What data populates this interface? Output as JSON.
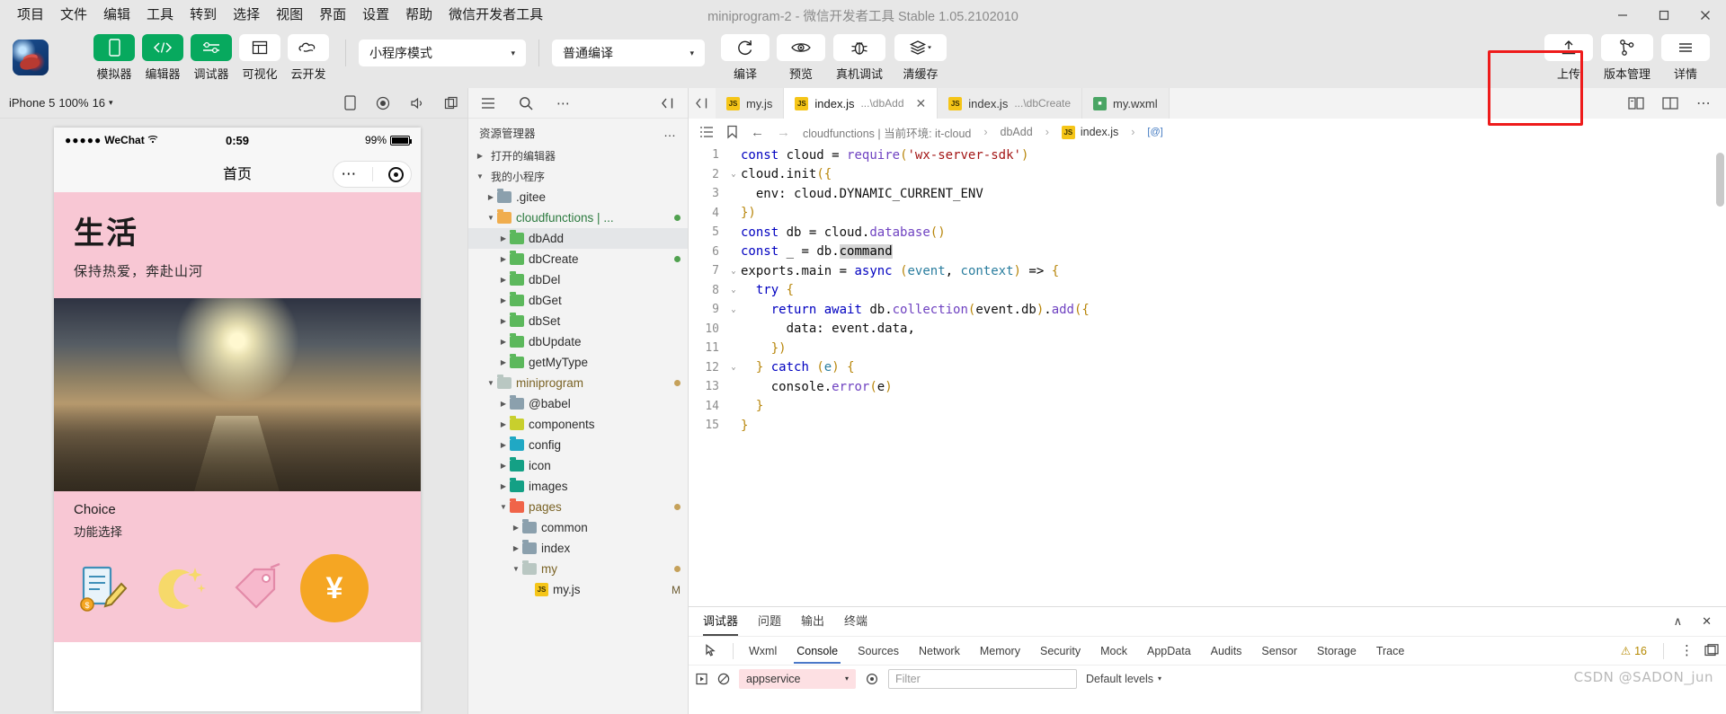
{
  "titlebar": {
    "menus": [
      "项目",
      "文件",
      "编辑",
      "工具",
      "转到",
      "选择",
      "视图",
      "界面",
      "设置",
      "帮助",
      "微信开发者工具"
    ],
    "window_title": "miniprogram-2  -  微信开发者工具 Stable 1.05.2102010",
    "controls": {
      "minimize": "─",
      "maximize": "☐",
      "close": "✕"
    }
  },
  "toolbar": {
    "mode_buttons": [
      {
        "label": "模拟器",
        "icon": "phone-icon",
        "style": "green"
      },
      {
        "label": "编辑器",
        "icon": "code-icon",
        "style": "green"
      },
      {
        "label": "调试器",
        "icon": "sliders-icon",
        "style": "green"
      },
      {
        "label": "可视化",
        "icon": "layout-icon",
        "style": "white"
      },
      {
        "label": "云开发",
        "icon": "cloud-icon",
        "style": "white"
      }
    ],
    "mode_select": {
      "value": "小程序模式",
      "caret": "▾"
    },
    "compile_select": {
      "value": "普通编译",
      "caret": "▾"
    },
    "action_buttons": [
      {
        "label": "编译",
        "icon": "refresh-icon"
      },
      {
        "label": "预览",
        "icon": "eye-icon"
      },
      {
        "label": "真机调试",
        "icon": "bug-icon"
      },
      {
        "label": "清缓存",
        "icon": "layers-icon",
        "caret": "▾"
      }
    ],
    "right_buttons": [
      {
        "label": "上传",
        "icon": "upload-icon",
        "highlighted": true
      },
      {
        "label": "版本管理",
        "icon": "git-branch-icon"
      },
      {
        "label": "详情",
        "icon": "hamburger-icon"
      }
    ],
    "highlight_color": "#ee1b1b",
    "accent_color": "#07a95e"
  },
  "simulator": {
    "device": "iPhone 5",
    "zoom": "100%",
    "scale": "16",
    "caret": "▾",
    "toolbar_icons": [
      "rotate-icon",
      "record-icon",
      "sound-icon",
      "copy-icon"
    ],
    "phone": {
      "status_bar": {
        "carrier": "WeChat",
        "signal_dots": "●●●●●",
        "wifi": "📶",
        "time": "0:59",
        "battery": "99%"
      },
      "nav_title": "首页",
      "banner": {
        "title": "生活",
        "subtitle": "保持热爱，奔赴山河"
      },
      "choice": {
        "title": "Choice",
        "subtitle": "功能选择"
      },
      "feature_icons": [
        "notepad-icon",
        "moon-icon",
        "tag-icon",
        "yuan-icon"
      ],
      "yuan_symbol": "¥"
    }
  },
  "explorer": {
    "title": "资源管理器",
    "more": "…",
    "toolbar_icons": [
      "list-icon",
      "search-icon",
      "more-icon",
      "collapse-icon"
    ],
    "sections": [
      {
        "label": "打开的编辑器",
        "expanded": false
      },
      {
        "label": "我的小程序",
        "expanded": true
      }
    ],
    "tree": [
      {
        "label": ".gitee",
        "depth": 1,
        "icon": "folder-grey",
        "expanded": false
      },
      {
        "label": "cloudfunctions | ...",
        "depth": 1,
        "icon": "folder-open-amber",
        "expanded": true,
        "badge": "green",
        "color": "green"
      },
      {
        "label": "dbAdd",
        "depth": 2,
        "icon": "folder-green",
        "expanded": false,
        "selected": true
      },
      {
        "label": "dbCreate",
        "depth": 2,
        "icon": "folder-green",
        "expanded": false,
        "badge": "green"
      },
      {
        "label": "dbDel",
        "depth": 2,
        "icon": "folder-green",
        "expanded": false
      },
      {
        "label": "dbGet",
        "depth": 2,
        "icon": "folder-green",
        "expanded": false
      },
      {
        "label": "dbSet",
        "depth": 2,
        "icon": "folder-green",
        "expanded": false
      },
      {
        "label": "dbUpdate",
        "depth": 2,
        "icon": "folder-green",
        "expanded": false
      },
      {
        "label": "getMyType",
        "depth": 2,
        "icon": "folder-green",
        "expanded": false
      },
      {
        "label": "miniprogram",
        "depth": 1,
        "icon": "folder-open-grey",
        "expanded": true,
        "badge": "yellow",
        "color": "amber"
      },
      {
        "label": "@babel",
        "depth": 2,
        "icon": "folder-grey",
        "expanded": false
      },
      {
        "label": "components",
        "depth": 2,
        "icon": "folder-yellow",
        "expanded": false
      },
      {
        "label": "config",
        "depth": 2,
        "icon": "folder-cyan",
        "expanded": false
      },
      {
        "label": "icon",
        "depth": 2,
        "icon": "folder-teal",
        "expanded": false
      },
      {
        "label": "images",
        "depth": 2,
        "icon": "folder-teal",
        "expanded": false
      },
      {
        "label": "pages",
        "depth": 2,
        "icon": "folder-open-red",
        "expanded": true,
        "badge": "yellow",
        "color": "amber"
      },
      {
        "label": "common",
        "depth": 3,
        "icon": "folder-grey",
        "expanded": false
      },
      {
        "label": "index",
        "depth": 3,
        "icon": "folder-grey",
        "expanded": false
      },
      {
        "label": "my",
        "depth": 3,
        "icon": "folder-open-grey",
        "expanded": true,
        "badge": "yellow",
        "color": "amber"
      },
      {
        "label": "my.js",
        "depth": 4,
        "icon": "js-file",
        "flag": "M"
      }
    ]
  },
  "editor": {
    "tabs": [
      {
        "label": "my.js",
        "icon": "js-file",
        "active": false
      },
      {
        "label": "index.js",
        "sub": "...\\dbAdd",
        "icon": "js-file",
        "active": true,
        "close": "✕"
      },
      {
        "label": "index.js",
        "sub": "...\\dbCreate",
        "icon": "js-file",
        "active": false
      },
      {
        "label": "my.wxml",
        "icon": "wxml-file",
        "active": false
      }
    ],
    "tab_right_icons": [
      "split-preview-icon",
      "split-editor-icon",
      "more-icon"
    ],
    "breadcrumb": {
      "nav_back": "←",
      "nav_forward": "→",
      "items": [
        "cloudfunctions | 当前环境: it-cloud",
        "dbAdd",
        "index.js",
        "[@]"
      ],
      "separator": "›",
      "left_icons": [
        "outline-icon",
        "bookmark-icon"
      ]
    },
    "lines": [
      {
        "n": 1,
        "fold": "",
        "text": "const cloud = require('wx-server-sdk')"
      },
      {
        "n": 2,
        "fold": "⌄",
        "text": "cloud.init({"
      },
      {
        "n": 3,
        "fold": "",
        "text": "  env: cloud.DYNAMIC_CURRENT_ENV"
      },
      {
        "n": 4,
        "fold": "",
        "text": "})"
      },
      {
        "n": 5,
        "fold": "",
        "text": "const db = cloud.database()"
      },
      {
        "n": 6,
        "fold": "",
        "text": "const _ = db.command"
      },
      {
        "n": 7,
        "fold": "⌄",
        "text": "exports.main = async (event, context) => {"
      },
      {
        "n": 8,
        "fold": "⌄",
        "text": "  try {"
      },
      {
        "n": 9,
        "fold": "⌄",
        "text": "    return await db.collection(event.db).add({"
      },
      {
        "n": 10,
        "fold": "",
        "text": "      data: event.data,"
      },
      {
        "n": 11,
        "fold": "",
        "text": "    })"
      },
      {
        "n": 12,
        "fold": "⌄",
        "text": "  } catch (e) {"
      },
      {
        "n": 13,
        "fold": "",
        "text": "    console.error(e)"
      },
      {
        "n": 14,
        "fold": "",
        "text": "  }"
      },
      {
        "n": 15,
        "fold": "",
        "text": "}"
      }
    ]
  },
  "panel": {
    "tabs": [
      {
        "label": "调试器",
        "active": true
      },
      {
        "label": "问题",
        "active": false
      },
      {
        "label": "输出",
        "active": false
      },
      {
        "label": "终端",
        "active": false
      }
    ],
    "panel_controls": {
      "collapse": "∧",
      "close": "✕"
    },
    "devtools_tabs": [
      {
        "label": "Wxml",
        "active": false
      },
      {
        "label": "Console",
        "active": true
      },
      {
        "label": "Sources",
        "active": false
      },
      {
        "label": "Network",
        "active": false
      },
      {
        "label": "Memory",
        "active": false
      },
      {
        "label": "Security",
        "active": false
      },
      {
        "label": "Mock",
        "active": false
      },
      {
        "label": "AppData",
        "active": false
      },
      {
        "label": "Audits",
        "active": false
      },
      {
        "label": "Sensor",
        "active": false
      },
      {
        "label": "Storage",
        "active": false
      },
      {
        "label": "Trace",
        "active": false
      }
    ],
    "warning_count": "16",
    "warning_icon": "warning-triangle-icon",
    "devtools_right_icons": [
      "kebab-menu-icon",
      "dock-icon"
    ],
    "console": {
      "execute_icon": "play-icon",
      "clear_icon": "no-entry-icon",
      "context": "appservice",
      "context_caret": "▾",
      "eye_icon": "eye-icon",
      "filter_placeholder": "Filter",
      "levels": "Default levels",
      "levels_caret": "▾",
      "settings_icon": "gear-icon"
    },
    "watermark": "CSDN @SADON_jun"
  }
}
